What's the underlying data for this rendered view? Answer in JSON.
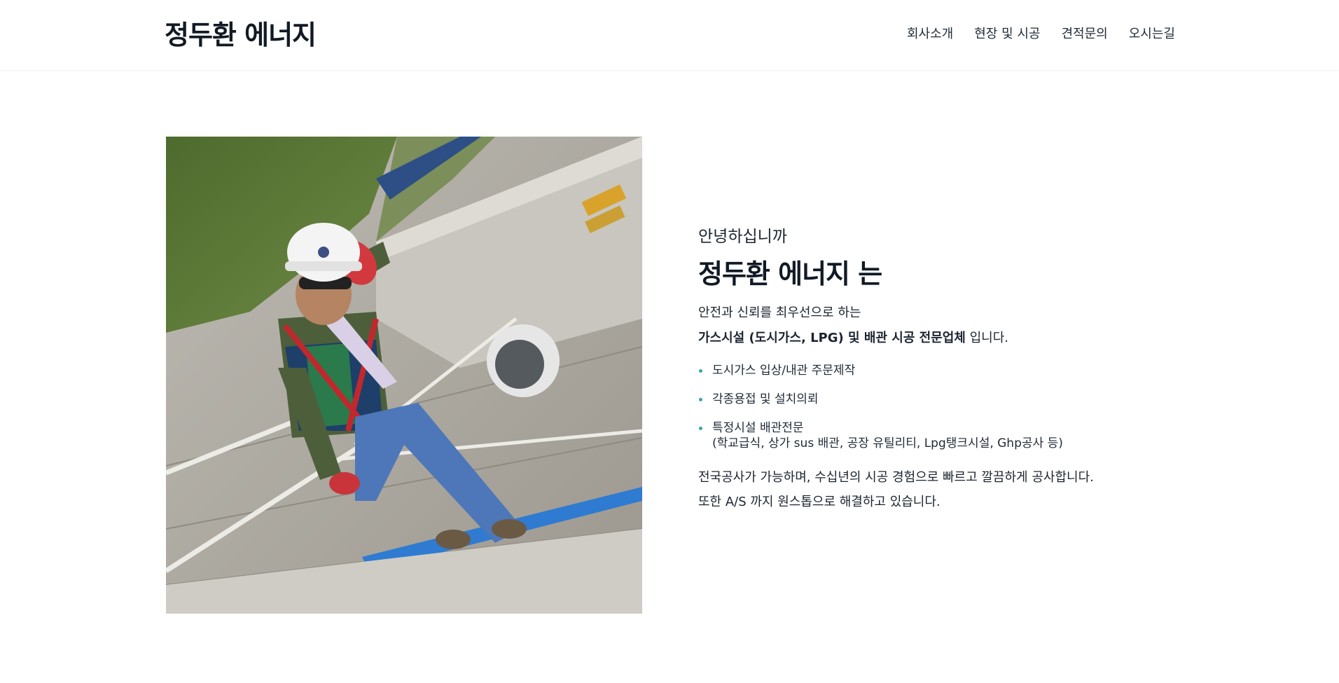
{
  "header": {
    "logo": "정두환 에너지",
    "nav": [
      "회사소개",
      "현장 및 시공",
      "견적문의",
      "오시는길"
    ]
  },
  "intro": {
    "greeting": "안녕하십니까",
    "company_heading": "정두환 에너지 는",
    "line1": "안전과 신뢰를 최우선으로 하는",
    "line2_bold": "가스시설 (도시가스, LPG) 및 배관 시공 전문업체",
    "line2_rest": " 입니다.",
    "services": [
      {
        "title": "도시가스 입상/내관 주문제작"
      },
      {
        "title": "각종용접 및 설치의뢰"
      },
      {
        "title": "특정시설 배관전문",
        "detail": "(학교급식, 상가 sus 배관, 공장 유틸리티, Lpg탱크시설, Ghp공사 등)"
      }
    ],
    "closing_line1": "전국공사가 가능하며, 수십년의 시공 경험으로 빠르고 깔끔하게 공사합니다.",
    "closing_line2": "또한 A/S 까지 원스톱으로 해결하고 있습니다."
  },
  "colors": {
    "bullet": "#3aa1b3",
    "heading": "#111a24",
    "text": "#1c2430"
  }
}
